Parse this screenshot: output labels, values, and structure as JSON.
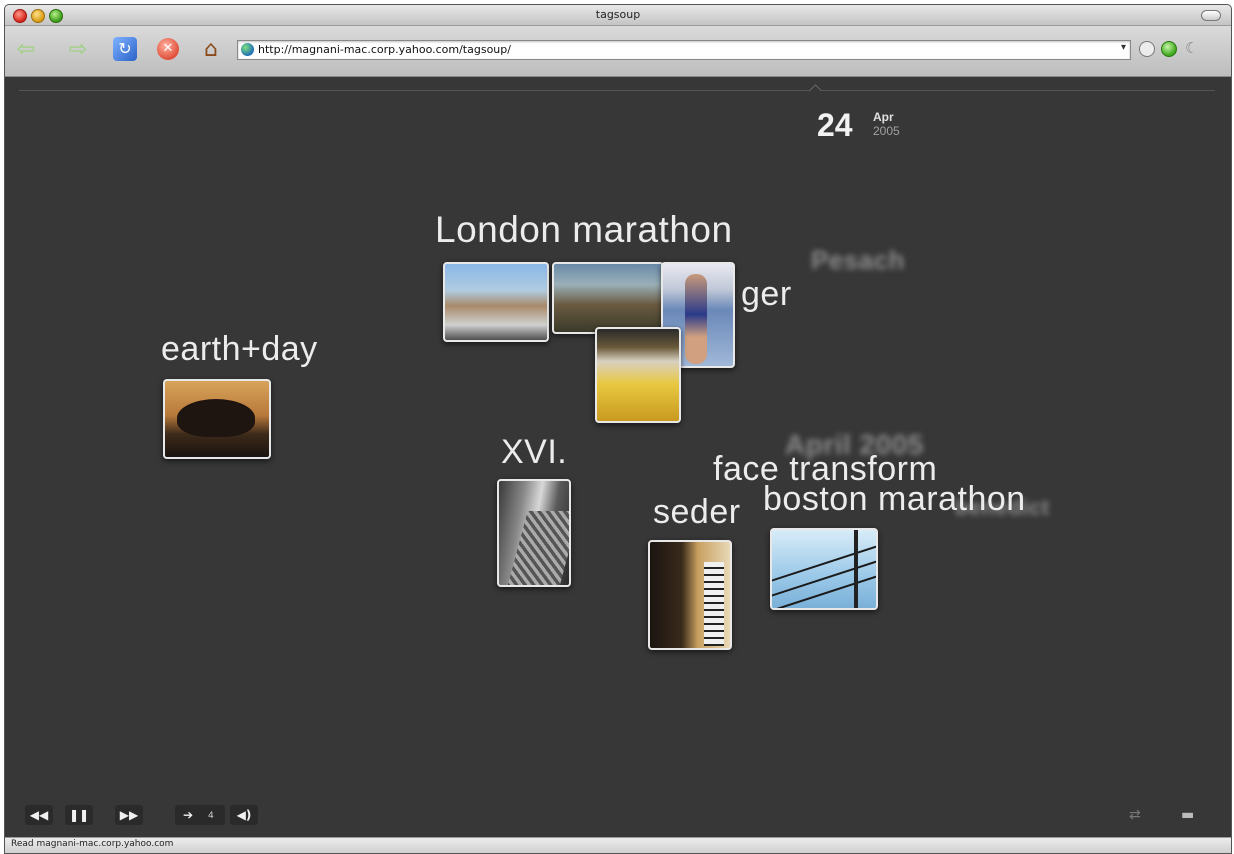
{
  "window": {
    "title": "tagsoup"
  },
  "toolbar": {
    "back_icon": "left-arrow-icon",
    "forward_icon": "right-arrow-icon",
    "reload_icon": "reload-icon",
    "stop_icon": "stop-icon",
    "home_icon": "home-icon",
    "url": "http://magnani-mac.corp.yahoo.com/tagsoup/"
  },
  "date": {
    "day": "24",
    "month": "Apr",
    "year": "2005"
  },
  "tags": {
    "london": "London marathon",
    "ger": "ger",
    "pesach": "Pesach",
    "earth": "earth+day",
    "xvi": "XVI.",
    "april": "April 2005",
    "face": "face transform",
    "seder": "seder",
    "boston": "boston marathon",
    "faded_right": "benedict"
  },
  "controls": {
    "rewind": "◀◀",
    "pause": "❚❚",
    "forward": "▶▶",
    "photo_count": "4",
    "volume": "◀)",
    "shuffle": "⇄",
    "menu": "▬"
  },
  "status": {
    "text": "Read magnani-mac.corp.yahoo.com"
  },
  "colors": {
    "background": "#373737",
    "text": "#ececec"
  }
}
